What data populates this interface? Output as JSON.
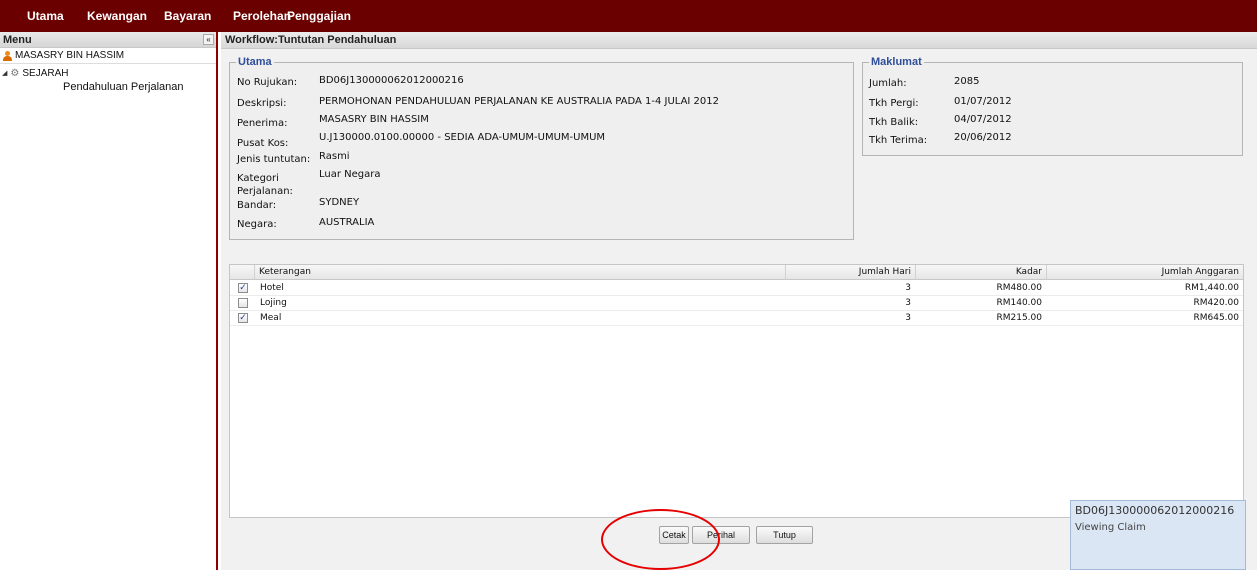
{
  "topnav": {
    "items": [
      "Utama",
      "Kewangan",
      "Bayaran",
      "Perolehan",
      "Penggajian"
    ]
  },
  "sidebar": {
    "title": "Menu",
    "collapse_glyph": "«",
    "user": "MASASRY BIN HASSIM",
    "tree_root": "SEJARAH",
    "tree_child": "Pendahuluan Perjalanan"
  },
  "main": {
    "title": "Workflow:Tuntutan Pendahuluan"
  },
  "utama": {
    "legend": "Utama",
    "fields": [
      {
        "label": "No Rujukan:",
        "value": "BD06J130000062012000216"
      },
      {
        "label": "Deskripsi:",
        "value": "PERMOHONAN PENDAHULUAN PERJALANAN KE AUSTRALIA PADA 1-4 JULAI 2012"
      },
      {
        "label": "Penerima:",
        "value": "MASASRY BIN HASSIM"
      },
      {
        "label": "Pusat Kos:",
        "value": "U.J130000.0100.00000 - SEDIA ADA-UMUM-UMUM-UMUM"
      },
      {
        "label": "Jenis tuntutan:",
        "value": "Rasmi"
      },
      {
        "label": "Kategori Perjalanan:",
        "value": "Luar Negara"
      },
      {
        "label": "Bandar:",
        "value": "SYDNEY"
      },
      {
        "label": "Negara:",
        "value": "AUSTRALIA"
      }
    ]
  },
  "maklumat": {
    "legend": "Maklumat",
    "fields": [
      {
        "label": "Jumlah:",
        "value": "2085"
      },
      {
        "label": "Tkh Pergi:",
        "value": "01/07/2012"
      },
      {
        "label": "Tkh Balik:",
        "value": "04/07/2012"
      },
      {
        "label": "Tkh Terima:",
        "value": "20/06/2012"
      }
    ]
  },
  "grid": {
    "headers": [
      "Keterangan",
      "Jumlah Hari",
      "Kadar",
      "Jumlah Anggaran"
    ],
    "rows": [
      {
        "checked": true,
        "keterangan": "Hotel",
        "hari": "3",
        "kadar": "RM480.00",
        "anggaran": "RM1,440.00"
      },
      {
        "checked": false,
        "keterangan": "Lojing",
        "hari": "3",
        "kadar": "RM140.00",
        "anggaran": "RM420.00"
      },
      {
        "checked": true,
        "keterangan": "Meal",
        "hari": "3",
        "kadar": "RM215.00",
        "anggaran": "RM645.00"
      }
    ],
    "check_glyph": "✓"
  },
  "buttons": {
    "cetak": "Cetak",
    "perihal": "Perihal",
    "tutup": "Tutup"
  },
  "toast": {
    "title": "BD06J130000062012000216",
    "subtitle": "Viewing Claim"
  },
  "colors": {
    "topbar": "#6b0000",
    "legend": "#2f4f9a",
    "annotation": "#e60000"
  }
}
